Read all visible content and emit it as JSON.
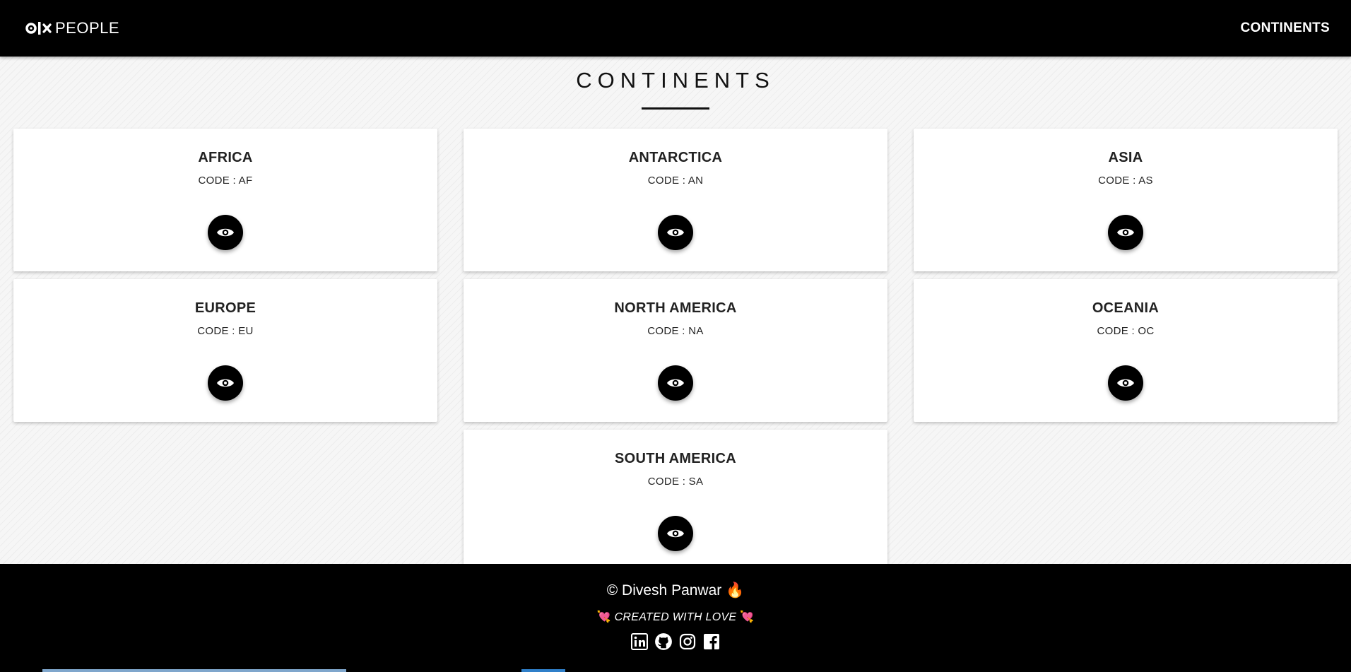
{
  "navbar": {
    "logo_mark": "olx-logo-mark",
    "brand_text": "PEOPLE",
    "link_label": "CONTINENTS"
  },
  "page": {
    "title": "CONTINENTS"
  },
  "continents": [
    {
      "name": "AFRICA",
      "code": "CODE : AF"
    },
    {
      "name": "ANTARCTICA",
      "code": "CODE : AN"
    },
    {
      "name": "ASIA",
      "code": "CODE : AS"
    },
    {
      "name": "EUROPE",
      "code": "CODE : EU"
    },
    {
      "name": "NORTH AMERICA",
      "code": "CODE : NA"
    },
    {
      "name": "OCEANIA",
      "code": "CODE : OC"
    },
    {
      "name": "SOUTH AMERICA",
      "code": "CODE : SA"
    }
  ],
  "card_action_icon": "eye-icon",
  "footer": {
    "copyright": "© Divesh Panwar 🔥",
    "tagline": "CREATED WITH LOVE",
    "tagline_heart": "💘",
    "social_icons": [
      "linkedin-icon",
      "github-icon",
      "instagram-icon",
      "facebook-icon"
    ]
  },
  "colors": {
    "header_bg": "#000000",
    "footer_bg": "#000000",
    "card_bg": "#ffffff",
    "button_bg": "#000000",
    "page_bg": "#f6f6f6"
  }
}
